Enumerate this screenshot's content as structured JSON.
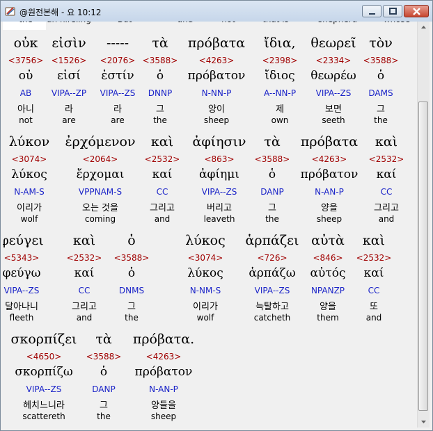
{
  "window": {
    "title": "@원전본해 - 요 10:12",
    "icon": "app-book-icon",
    "controls": [
      "minimize-icon",
      "maximize-icon",
      "close-icon"
    ]
  },
  "cut_off_top_row": [
    "the",
    "an hireling",
    "But",
    "and",
    "not",
    "that is",
    "shepherd",
    "whose"
  ],
  "verse_lines": [
    [
      {
        "greek": "οὐκ",
        "strong": "<3756>",
        "lemma": "οὐ",
        "parse": "AB",
        "korean": "아니",
        "english": "not"
      },
      {
        "greek": "εἰσὶν",
        "strong": "<1526>",
        "lemma": "εἰσί",
        "parse": "VIPA--ZP",
        "korean": "라",
        "english": "are"
      },
      {
        "greek": "-----",
        "strong": "<2076>",
        "lemma": "ἐστίν",
        "parse": "VIPA--ZS",
        "korean": "라",
        "english": "are"
      },
      {
        "greek": "τὰ",
        "strong": "<3588>",
        "lemma": "ὁ",
        "parse": "DNNP",
        "korean": "그",
        "english": "the"
      },
      {
        "greek": "πρόβατα",
        "strong": "<4263>",
        "lemma": "πρόβατον",
        "parse": "N-NN-P",
        "korean": "양이",
        "english": "sheep"
      },
      {
        "greek": "ἴδια,",
        "strong": "<2398>",
        "lemma": "ἴδιος",
        "parse": "A--NN-P",
        "korean": "제",
        "english": "own"
      },
      {
        "greek": "θεωρεῖ",
        "strong": "<2334>",
        "lemma": "θεωρέω",
        "parse": "VIPA--ZS",
        "korean": "보면",
        "english": "seeth"
      },
      {
        "greek": "τὸν",
        "strong": "<3588>",
        "lemma": "ὁ",
        "parse": "DAMS",
        "korean": "그",
        "english": "the"
      }
    ],
    [
      {
        "greek": "λύκον",
        "strong": "<3074>",
        "lemma": "λύκος",
        "parse": "N-AM-S",
        "korean": "이리가",
        "english": "wolf"
      },
      {
        "greek": "ἐρχόμενον",
        "strong": "<2064>",
        "lemma": "ἔρχομαι",
        "parse": "VPPNAM-S",
        "korean": "오는 것을",
        "english": "coming"
      },
      {
        "greek": "καὶ",
        "strong": "<2532>",
        "lemma": "καί",
        "parse": "CC",
        "korean": "그리고",
        "english": "and"
      },
      {
        "greek": "ἀφίησιν",
        "strong": "<863>",
        "lemma": "ἀφίημι",
        "parse": "VIPA--ZS",
        "korean": "버리고",
        "english": "leaveth"
      },
      {
        "greek": "τὰ",
        "strong": "<3588>",
        "lemma": "ὁ",
        "parse": "DANP",
        "korean": "그",
        "english": "the"
      },
      {
        "greek": "πρόβατα",
        "strong": "<4263>",
        "lemma": "πρόβατον",
        "parse": "N-AN-P",
        "korean": "양을",
        "english": "sheep"
      },
      {
        "greek": "καὶ",
        "strong": "<2532>",
        "lemma": "καί",
        "parse": "CC",
        "korean": "그리고",
        "english": "and"
      }
    ],
    [
      {
        "greek": "φεύγει",
        "strong": "<5343>",
        "lemma": "φεύγω",
        "parse": "VIPA--ZS",
        "korean": "달아나니",
        "english": "fleeth"
      },
      {
        "greek": "καὶ",
        "strong": "<2532>",
        "lemma": "καί",
        "parse": "CC",
        "korean": "그리고",
        "english": "and"
      },
      {
        "greek": "ὁ",
        "strong": "<3588>",
        "lemma": "ὁ",
        "parse": "DNMS",
        "korean": "그",
        "english": "the"
      },
      {
        "greek": "λύκος",
        "strong": "<3074>",
        "lemma": "λύκος",
        "parse": "N-NM-S",
        "korean": "이리가",
        "english": "wolf"
      },
      {
        "greek": "ἁρπάζει",
        "strong": "<726>",
        "lemma": "ἁρπάζω",
        "parse": "VIPA--ZS",
        "korean": "늑탈하고",
        "english": "catcheth"
      },
      {
        "greek": "αὐτὰ",
        "strong": "<846>",
        "lemma": "αὐτός",
        "parse": "NPANZP",
        "korean": "양을",
        "english": "them"
      },
      {
        "greek": "καὶ",
        "strong": "<2532>",
        "lemma": "καί",
        "parse": "CC",
        "korean": "또",
        "english": "and"
      }
    ],
    [
      {
        "greek": "σκορπίζει",
        "strong": "<4650>",
        "lemma": "σκορπίζω",
        "parse": "VIPA--ZS",
        "korean": "헤치느니라",
        "english": "scattereth"
      },
      {
        "greek": "τὰ",
        "strong": "<3588>",
        "lemma": "ὁ",
        "parse": "DANP",
        "korean": "그",
        "english": "the"
      },
      {
        "greek": "πρόβατα.",
        "strong": "<4263>",
        "lemma": "πρόβατον",
        "parse": "N-AN-P",
        "korean": "양들을",
        "english": "sheep"
      }
    ]
  ],
  "colors": {
    "greek": "#000000",
    "strong_number": "#a00000",
    "parsing_code": "#1a23c8",
    "background": "#f0f0f0"
  }
}
